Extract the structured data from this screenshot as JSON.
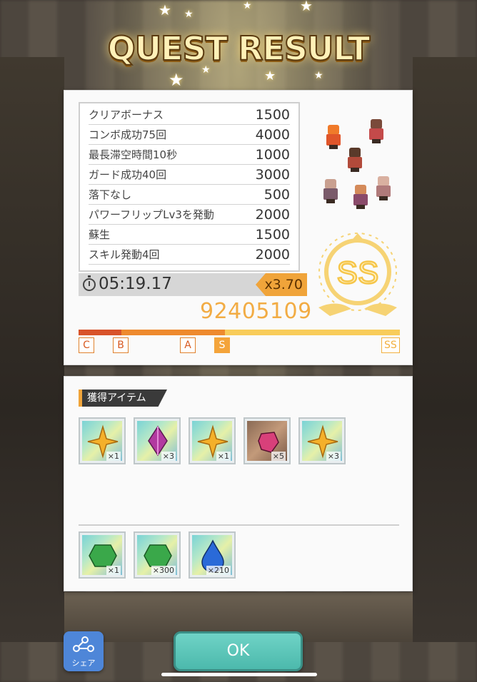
{
  "header": {
    "title": "QUEST RESULT"
  },
  "bonuses": [
    {
      "label": "クリアボーナス",
      "value": "1500"
    },
    {
      "label": "コンボ成功75回",
      "value": "4000"
    },
    {
      "label": "最長滞空時間10秒",
      "value": "1000"
    },
    {
      "label": "ガード成功40回",
      "value": "3000"
    },
    {
      "label": "落下なし",
      "value": "500"
    },
    {
      "label": "パワーフリップLv3を発動",
      "value": "2000"
    },
    {
      "label": "蘇生",
      "value": "1500"
    },
    {
      "label": "スキル発動4回",
      "value": "2000"
    }
  ],
  "result": {
    "time": "05:19.17",
    "multiplier": "x3.70",
    "score": "92405109",
    "rank": "SS",
    "rank_marks": [
      "C",
      "B",
      "A",
      "S",
      "SS"
    ]
  },
  "items": {
    "section_label": "獲得アイテム",
    "drops": [
      {
        "icon": "gold-star-crystal-icon",
        "qty": "×1"
      },
      {
        "icon": "purple-gem-icon",
        "qty": "×3"
      },
      {
        "icon": "gold-star-crystal-icon",
        "qty": "×1"
      },
      {
        "icon": "pink-ore-icon",
        "qty": "×5"
      },
      {
        "icon": "gold-star-crystal-icon",
        "qty": "×3"
      }
    ],
    "rewards": [
      {
        "icon": "green-gem-icon",
        "qty": "×1"
      },
      {
        "icon": "green-gem-icon",
        "qty": "×300"
      },
      {
        "icon": "blue-drop-icon",
        "qty": "×210"
      }
    ]
  },
  "footer": {
    "share_label": "シェア",
    "ok_label": "OK"
  },
  "colors": {
    "accent_orange": "#f0a43a",
    "ok_teal": "#4cb9ac",
    "share_blue": "#4e86d8",
    "rank_gold": "#f8cc5a"
  }
}
